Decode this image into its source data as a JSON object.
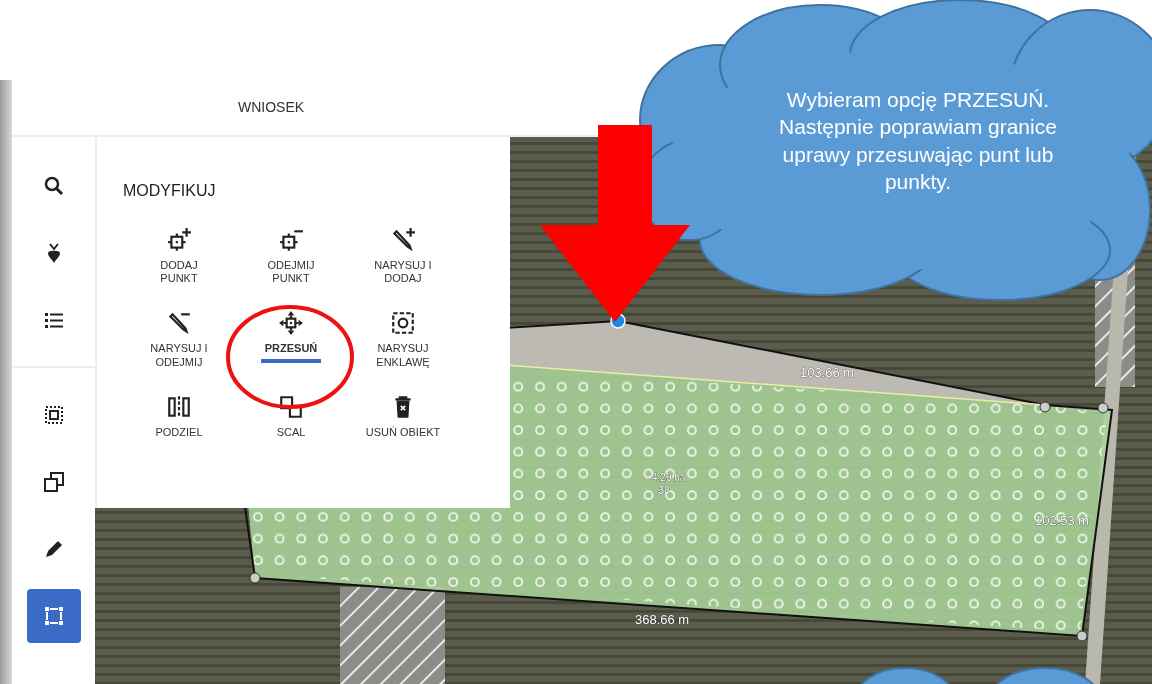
{
  "header": {
    "title": "WNIOSEK"
  },
  "sidebar": {
    "items": [
      {
        "selected": false
      },
      {
        "selected": false
      },
      {
        "selected": false
      },
      {
        "selected": false
      },
      {
        "selected": false
      },
      {
        "selected": false
      },
      {
        "selected": true
      }
    ]
  },
  "panel": {
    "title": "MODYFIKUJ",
    "tools": [
      {
        "label": "DODAJ\nPUNKT",
        "selected": false
      },
      {
        "label": "ODEJMIJ\nPUNKT",
        "selected": false
      },
      {
        "label": "NARYSUJ I\nDODAJ",
        "selected": false
      },
      {
        "label": "NARYSUJ I\nODEJMIJ",
        "selected": false
      },
      {
        "label": "PRZESUŃ",
        "selected": true
      },
      {
        "label": "NARYSUJ\nENKLAWĘ",
        "selected": false
      },
      {
        "label": "PODZIEL",
        "selected": false
      },
      {
        "label": "SCAL",
        "selected": false
      },
      {
        "label": "USUŃ OBIEKT",
        "selected": false
      }
    ]
  },
  "map": {
    "labels": [
      {
        "text": "103.66 m"
      },
      {
        "text": "4.29 ha"
      },
      {
        "text": "38"
      },
      {
        "text": "102.53 m"
      },
      {
        "text": "368.66 m"
      }
    ]
  },
  "callout": {
    "text": "Wybieram opcję PRZESUŃ. Następnie poprawiam granice uprawy przesuwając punt lub punkty."
  }
}
